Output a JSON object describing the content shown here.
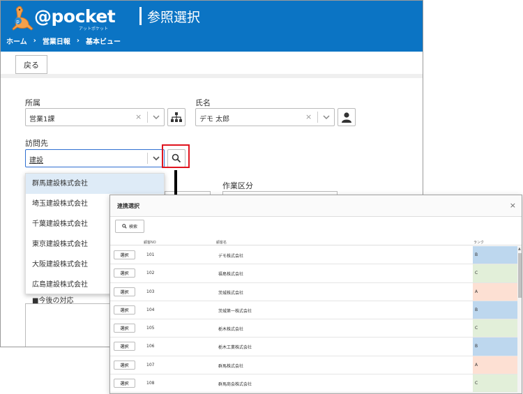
{
  "app": {
    "logo": "@pocket",
    "logo_sub": "アットポケット",
    "title": "参照選択",
    "breadcrumb": [
      "ホーム",
      "営業日報",
      "基本ビュー"
    ],
    "breadcrumb_sep": "›"
  },
  "toolbar": {
    "back_label": "戻る"
  },
  "form": {
    "affiliation": {
      "label": "所属",
      "value": "営業1課"
    },
    "name": {
      "label": "氏名",
      "value": "デモ 太郎"
    },
    "visit": {
      "label": "訪問先",
      "value": "建設"
    },
    "work_type_label": "作業区分",
    "future_label": "■今後の対応",
    "clear_glyph": "×",
    "dropdown": [
      "群馬建設株式会社",
      "埼玉建設株式会社",
      "千葉建設株式会社",
      "東京建設株式会社",
      "大阪建設株式会社",
      "広島建設株式会社"
    ]
  },
  "modal": {
    "title": "連携選択",
    "close": "×",
    "search_label": "検索",
    "columns": {
      "no": "顧客NO",
      "name": "顧客名",
      "rank": "ランク"
    },
    "select_label": "選択",
    "rows": [
      {
        "no": "101",
        "name": "デモ株式会社",
        "rank": "B"
      },
      {
        "no": "102",
        "name": "福島株式会社",
        "rank": "C"
      },
      {
        "no": "103",
        "name": "茨城株式会社",
        "rank": "A"
      },
      {
        "no": "104",
        "name": "茨城第一株式会社",
        "rank": "B"
      },
      {
        "no": "105",
        "name": "栃木株式会社",
        "rank": "C"
      },
      {
        "no": "106",
        "name": "栃木工業株式会社",
        "rank": "B"
      },
      {
        "no": "107",
        "name": "群馬株式会社",
        "rank": "A"
      },
      {
        "no": "108",
        "name": "群馬商会株式会社",
        "rank": "C"
      }
    ],
    "rank_colors": {
      "A": "#fde0d3",
      "B": "#bdd7ee",
      "C": "#e2efd9"
    }
  },
  "colors": {
    "header": "#0b74c4",
    "highlight": "#e0141e"
  }
}
